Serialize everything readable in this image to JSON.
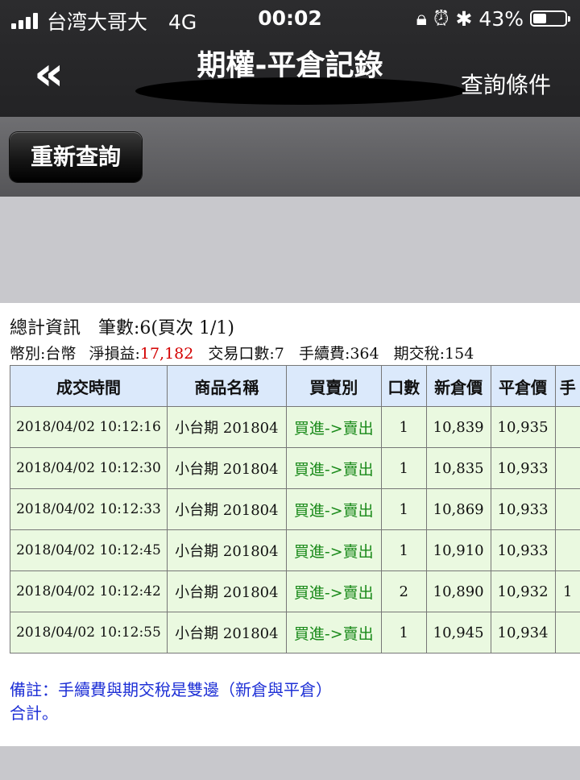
{
  "status_bar": {
    "carrier": "台湾大哥大",
    "network": "4G",
    "time": "00:02",
    "battery": "43%",
    "battery_level": 0.43
  },
  "nav": {
    "back_icon": "«",
    "title": "期權-平倉記錄",
    "query_conditions": "查詢條件"
  },
  "toolbar": {
    "requery_label": "重新查詢"
  },
  "summary": {
    "heading": "總計資訊",
    "count": "筆數:6(頁次 1/1)",
    "currency": "幣別:台幣",
    "net_pl_label": "淨損益:",
    "net_pl_value": "17,182",
    "lots": "交易口數:7",
    "fee": "手續費:364",
    "tax": "期交稅:154"
  },
  "table": {
    "headers": [
      "成交時間",
      "商品名稱",
      "買賣別",
      "口數",
      "新倉價",
      "平倉價",
      "手"
    ],
    "rows": [
      {
        "time": "2018/04/02 10:12:16",
        "product": "小台期 201804",
        "side": "買進->賣出",
        "qty": "1",
        "open": "10,839",
        "close": "10,935",
        "extra": ""
      },
      {
        "time": "2018/04/02 10:12:30",
        "product": "小台期 201804",
        "side": "買進->賣出",
        "qty": "1",
        "open": "10,835",
        "close": "10,933",
        "extra": ""
      },
      {
        "time": "2018/04/02 10:12:33",
        "product": "小台期 201804",
        "side": "買進->賣出",
        "qty": "1",
        "open": "10,869",
        "close": "10,933",
        "extra": ""
      },
      {
        "time": "2018/04/02 10:12:45",
        "product": "小台期 201804",
        "side": "買進->賣出",
        "qty": "1",
        "open": "10,910",
        "close": "10,933",
        "extra": ""
      },
      {
        "time": "2018/04/02 10:12:42",
        "product": "小台期 201804",
        "side": "買進->賣出",
        "qty": "2",
        "open": "10,890",
        "close": "10,932",
        "extra": "1"
      },
      {
        "time": "2018/04/02 10:12:55",
        "product": "小台期 201804",
        "side": "買進->賣出",
        "qty": "1",
        "open": "10,945",
        "close": "10,934",
        "extra": ""
      }
    ]
  },
  "note": "備註：手續費與期交稅是雙邊（新倉與平倉）合計。",
  "colors": {
    "header_bg": "#dbe9fb",
    "row_bg": "#eaf9e0",
    "side_text": "#1a8a1a",
    "pl_positive": "#d40000",
    "note_text": "#1d2fd6"
  }
}
